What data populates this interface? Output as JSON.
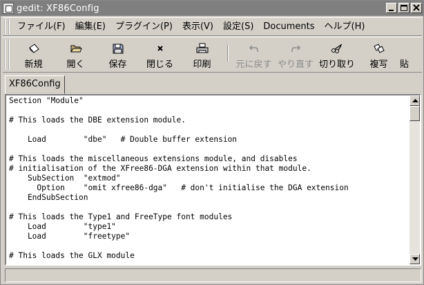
{
  "window": {
    "title": "gedit: XF86Config"
  },
  "menubar": {
    "items": [
      "ファイル(F)",
      "編集(E)",
      "プラグイン(P)",
      "表示(V)",
      "設定(S)",
      "Documents",
      "ヘルプ(H)"
    ]
  },
  "toolbar": {
    "new_label": "新規",
    "open_label": "開く",
    "save_label": "保存",
    "close_label": "閉じる",
    "print_label": "印刷",
    "undo_label": "元に戻す",
    "redo_label": "やり直す",
    "cut_label": "切り取り",
    "copy_label": "複写",
    "paste_label": "貼"
  },
  "tabs": [
    {
      "label": "XF86Config",
      "active": true
    }
  ],
  "editor": {
    "lines": [
      "Section \"Module\"",
      "",
      "# This loads the DBE extension module.",
      "",
      "    Load        \"dbe\"   # Double buffer extension",
      "",
      "# This loads the miscellaneous extensions module, and disables",
      "# initialisation of the XFree86-DGA extension within that module.",
      "    SubSection  \"extmod\"",
      "      Option    \"omit xfree86-dga\"   # don't initialise the DGA extension",
      "    EndSubSection",
      "",
      "# This loads the Type1 and FreeType font modules",
      "    Load        \"type1\"",
      "    Load        \"freetype\"",
      "",
      "# This loads the GLX module",
      ""
    ]
  },
  "icons": {
    "new": "new-file-icon",
    "open": "open-folder-icon",
    "save": "floppy-disk-icon",
    "close": "close-x-icon",
    "print": "printer-icon",
    "undo": "undo-arrow-icon",
    "redo": "redo-arrow-icon",
    "cut": "scissors-icon",
    "copy": "copy-icon"
  },
  "status": {
    "text": ""
  }
}
